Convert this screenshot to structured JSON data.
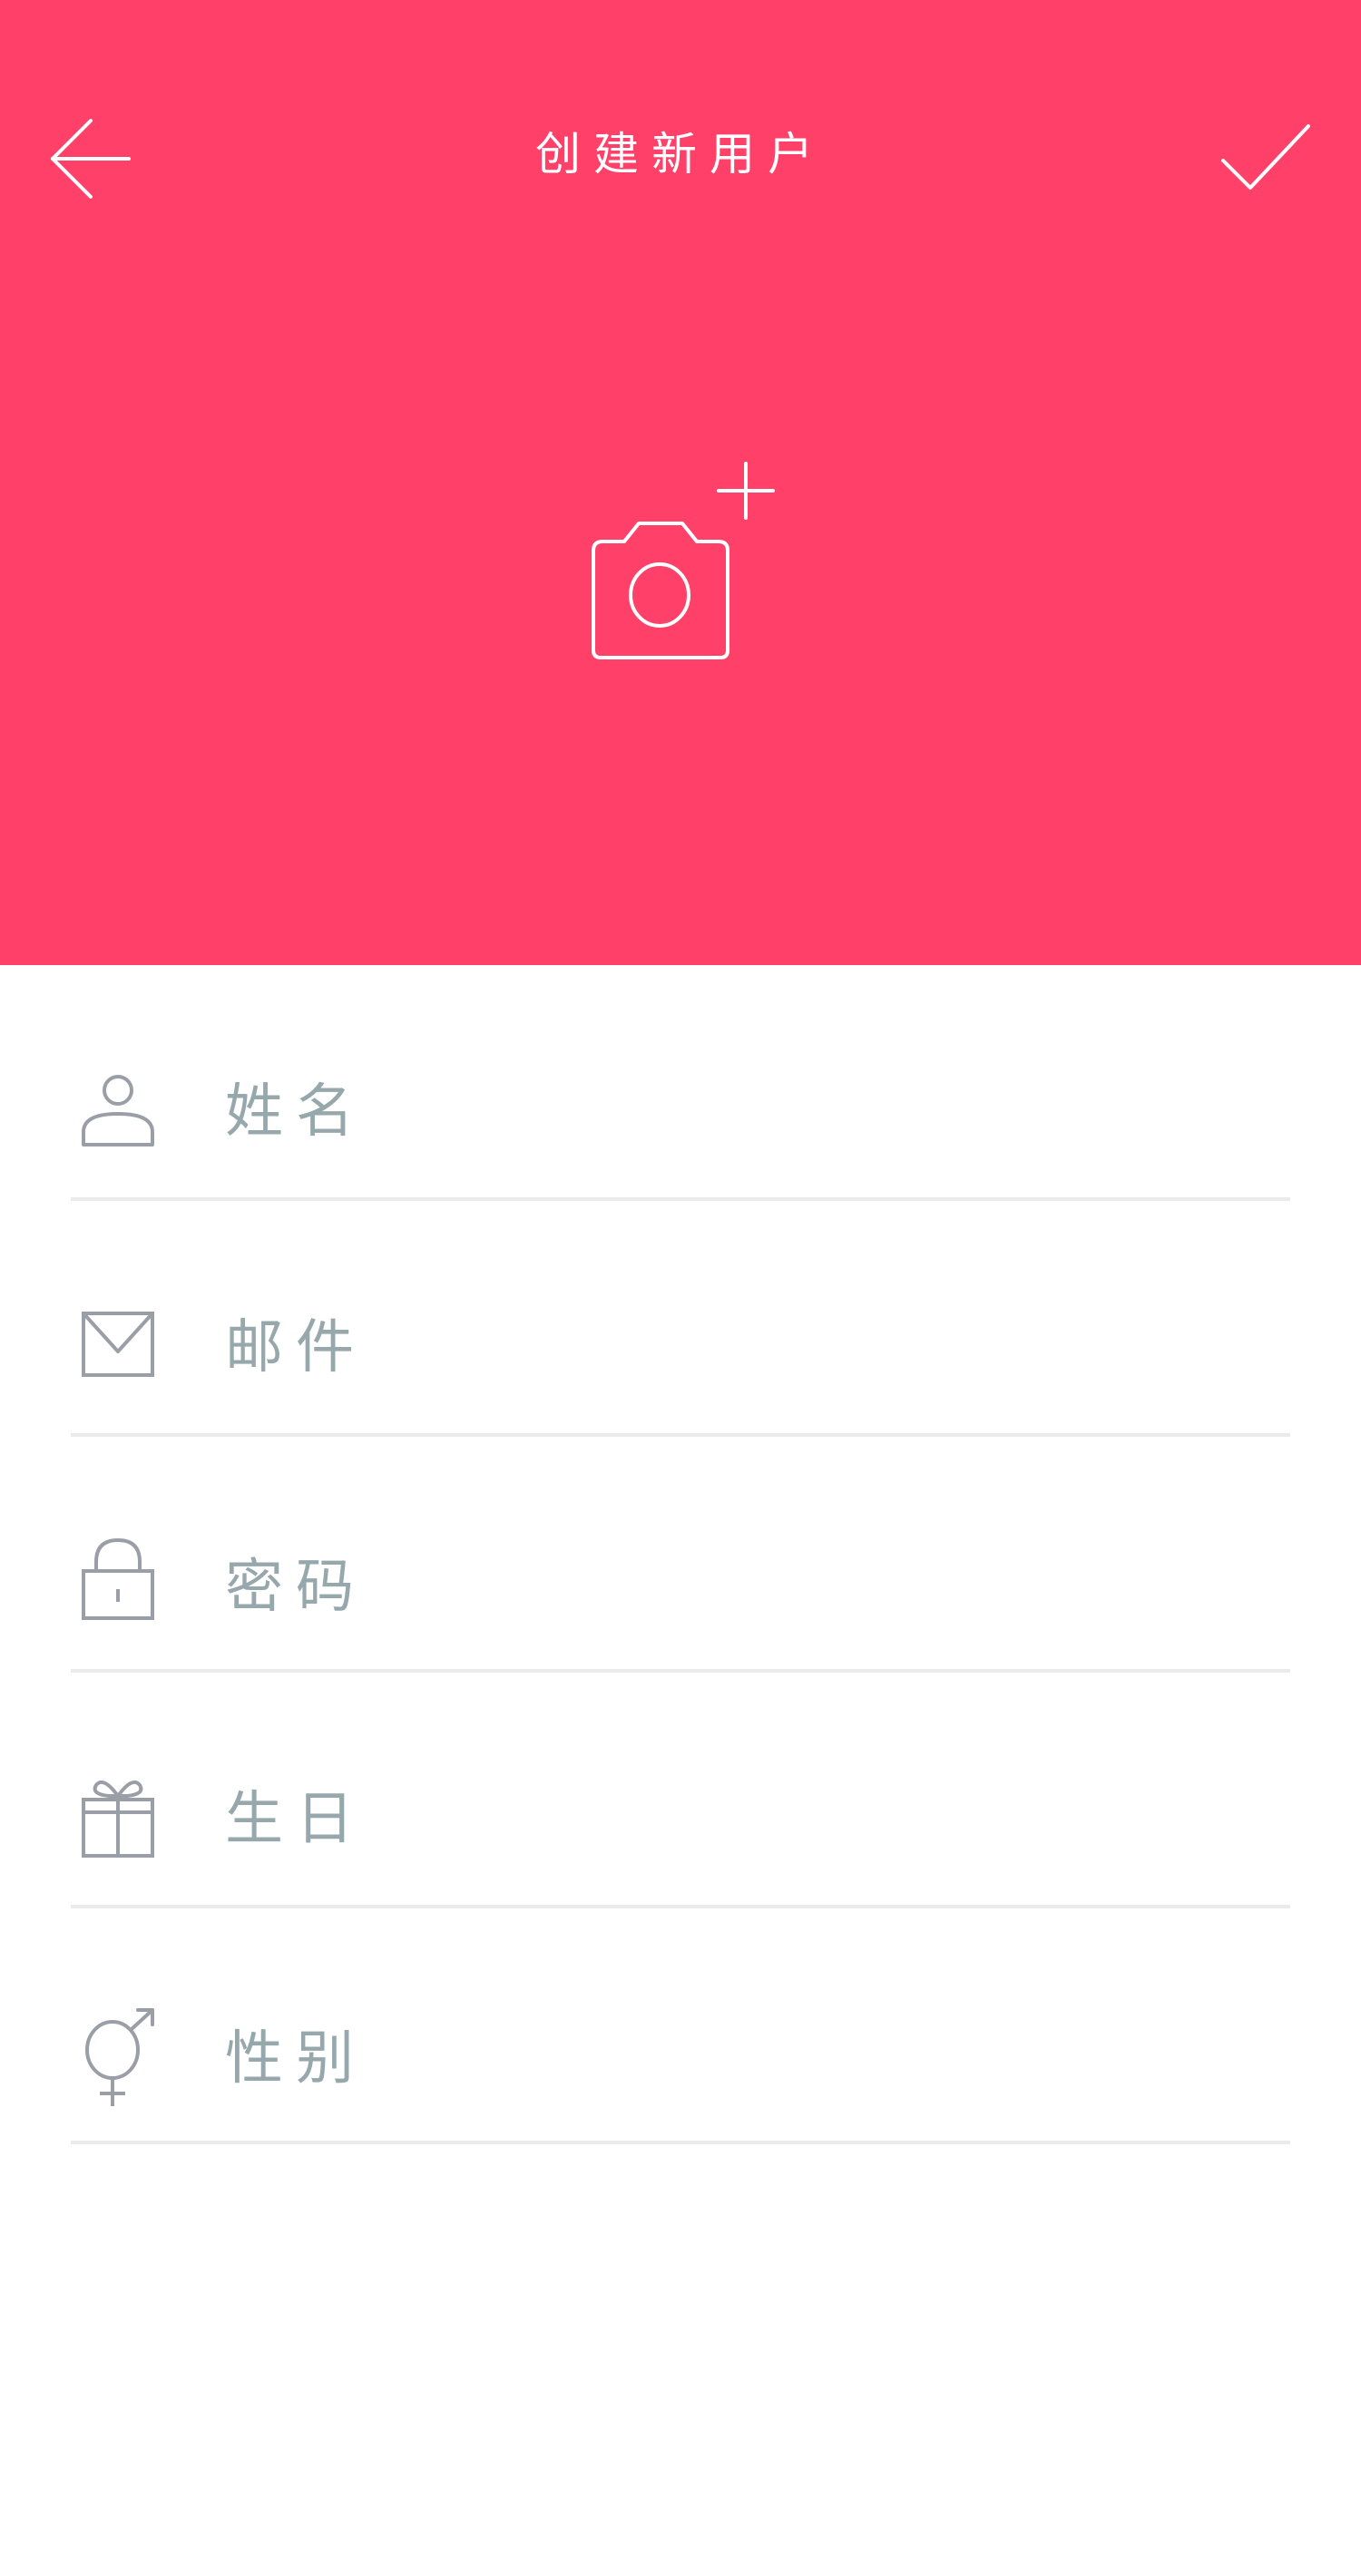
{
  "header": {
    "title": "创建新用户",
    "background_color": "#FF4068",
    "back_icon": "arrow-left-icon",
    "confirm_icon": "check-icon",
    "avatar_icon": "camera-add-icon"
  },
  "form": {
    "fields": [
      {
        "id": "name",
        "icon": "person-icon",
        "placeholder": "姓名",
        "value": ""
      },
      {
        "id": "email",
        "icon": "envelope-icon",
        "placeholder": "邮件",
        "value": ""
      },
      {
        "id": "password",
        "icon": "lock-icon",
        "placeholder": "密码",
        "value": ""
      },
      {
        "id": "birthday",
        "icon": "gift-icon",
        "placeholder": "生日",
        "value": ""
      },
      {
        "id": "gender",
        "icon": "gender-icon",
        "placeholder": "性别",
        "value": ""
      }
    ],
    "placeholder_color": "#96A8AC",
    "icon_color": "#9A9EA6",
    "divider_color": "#EAEBED"
  }
}
